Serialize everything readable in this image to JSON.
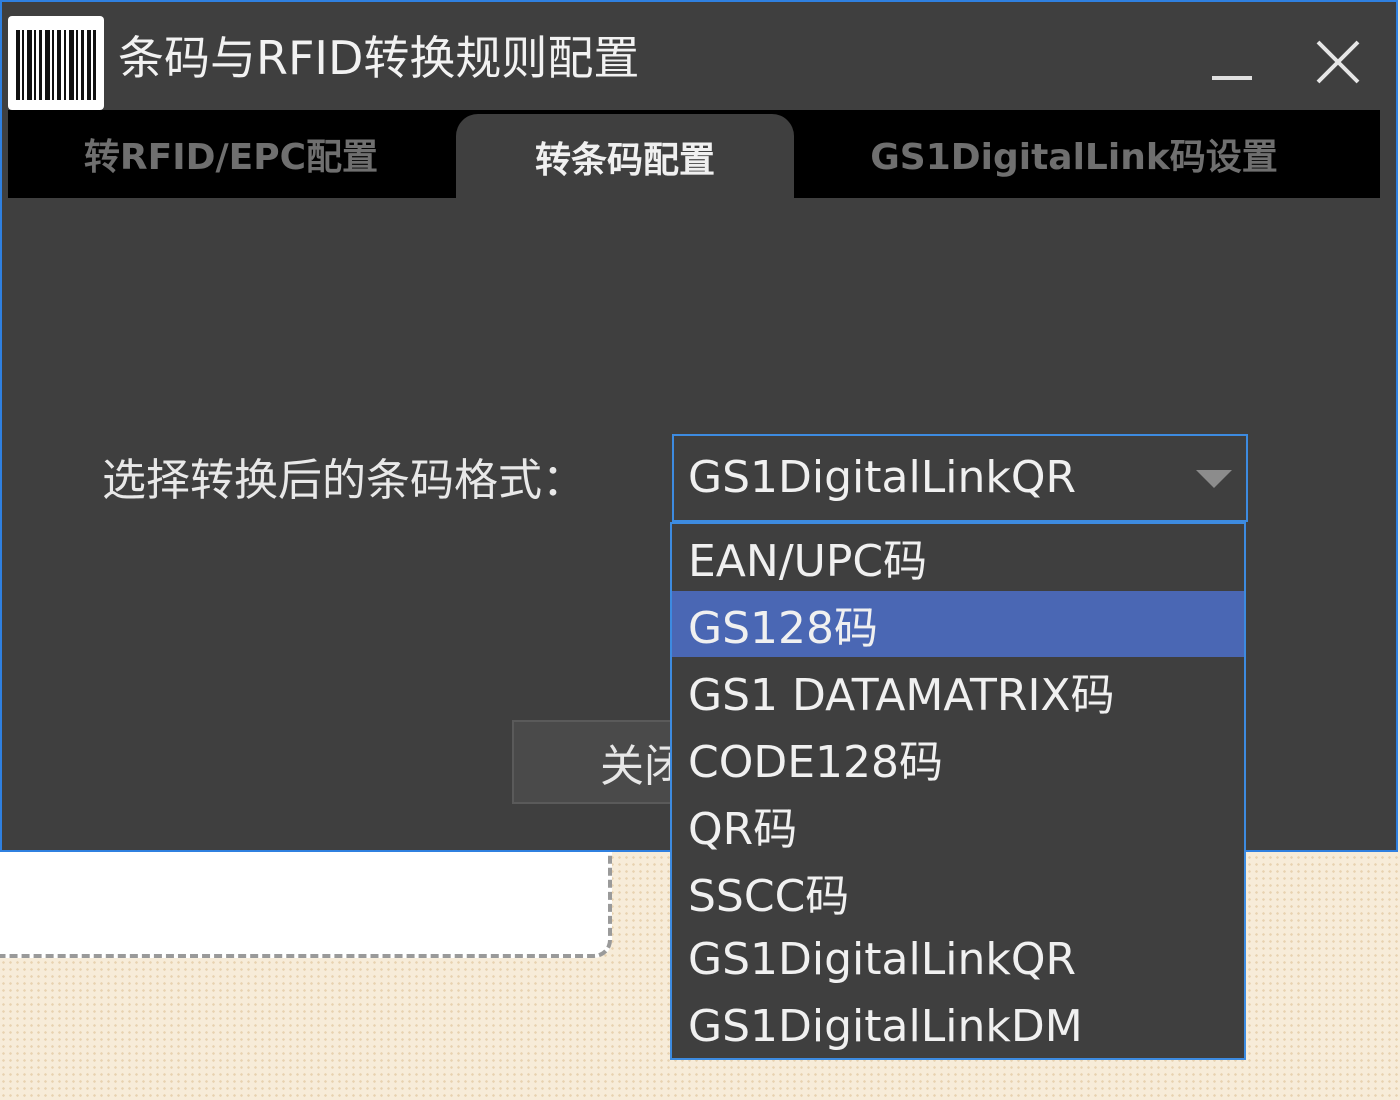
{
  "window": {
    "title": "条码与RFID转换规则配置",
    "icon": "barcode-icon"
  },
  "tabs": [
    {
      "label": "转RFID/EPC配置",
      "active": false
    },
    {
      "label": "转条码配置",
      "active": true
    },
    {
      "label": "GS1DigitalLink码设置",
      "active": false
    }
  ],
  "form": {
    "format_label": "选择转换后的条码格式：",
    "selected_value": "GS1DigitalLinkQR"
  },
  "dropdown": {
    "options": [
      "EAN/UPC码",
      "GS128码",
      "GS1  DATAMATRIX码",
      "CODE128码",
      "QR码",
      "SSCC码",
      "GS1DigitalLinkQR",
      "GS1DigitalLinkDM"
    ],
    "highlighted": "GS128码"
  },
  "buttons": {
    "close_label": "关闭"
  },
  "colors": {
    "window_bg": "#3f3f3f",
    "border_accent": "#2f80e0",
    "highlight": "#4a67b4"
  }
}
